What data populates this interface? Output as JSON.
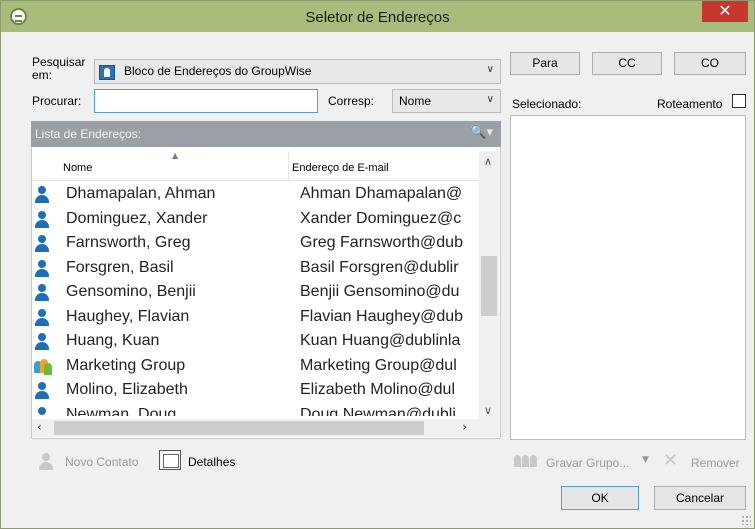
{
  "window": {
    "title": "Seletor de Endereços",
    "close_glyph": "✕"
  },
  "search": {
    "label_line1": "Pesquisar",
    "label_line2": "em:",
    "book_value": "Bloco de Endereços do GroupWise",
    "book_icon": "address-book-icon",
    "find_label": "Procurar:",
    "find_value": "",
    "match_label": "Corresp:",
    "match_value": "Nome"
  },
  "list": {
    "title": "Lista de Endereços:",
    "search_icon": "🔍▾",
    "columns": {
      "name": "Nome",
      "email": "Endereço de E-mail"
    },
    "rows": [
      {
        "type": "person",
        "name": "Dhamapalan, Ahman",
        "email": "Ahman Dhamapalan@"
      },
      {
        "type": "person",
        "name": "Dominguez, Xander",
        "email": "Xander Dominguez@c"
      },
      {
        "type": "person",
        "name": "Farnsworth, Greg",
        "email": "Greg Farnsworth@dub"
      },
      {
        "type": "person",
        "name": "Forsgren, Basil",
        "email": "Basil Forsgren@dublir"
      },
      {
        "type": "person",
        "name": "Gensomino, Benjii",
        "email": "Benjii Gensomino@du"
      },
      {
        "type": "person",
        "name": "Haughey, Flavian",
        "email": "Flavian Haughey@dub"
      },
      {
        "type": "person",
        "name": "Huang, Kuan",
        "email": "Kuan Huang@dublinla"
      },
      {
        "type": "group",
        "name": "Marketing Group",
        "email": "Marketing Group@dul"
      },
      {
        "type": "person",
        "name": "Molino, Elizabeth",
        "email": "Elizabeth Molino@dul"
      },
      {
        "type": "person",
        "name": "Newman, Doug",
        "email": "Doug Newman@dubli"
      }
    ]
  },
  "buttons": {
    "to": "Para",
    "cc": "CC",
    "bc": "CO",
    "new_contact": "Novo Contato",
    "details": "Detalhes",
    "save_group": "Gravar Grupo...",
    "remove": "Remover",
    "ok": "OK",
    "cancel": "Cancelar"
  },
  "selected": {
    "label": "Selecionado:",
    "routing_label": "Roteamento",
    "routing_checked": false
  },
  "colors": {
    "titlebar": "#a8bd7c",
    "close": "#c7372f",
    "icon_blue": "#1d6fb8",
    "list_header": "#9aa0a6"
  }
}
